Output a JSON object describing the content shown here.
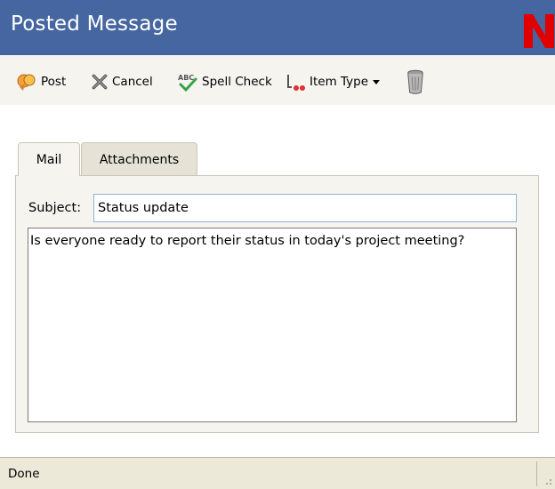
{
  "window": {
    "title": "Posted Message",
    "title_color": "#ffffff",
    "titlebar_bg": "#4566a0",
    "logo_letter": "N",
    "logo_color": "#e00000"
  },
  "toolbar": {
    "post_label": "Post",
    "cancel_label": "Cancel",
    "spell_label": "Spell Check",
    "item_type_label": "Item Type",
    "icons": [
      "post-icon",
      "cancel-icon",
      "spell-check-icon",
      "item-type-icon",
      "chevron-down-icon",
      "trash-icon"
    ]
  },
  "tabs": [
    {
      "label": "Mail",
      "active": true
    },
    {
      "label": "Attachments",
      "active": false
    }
  ],
  "form": {
    "subject_label": "Subject:",
    "subject_value": "Status update",
    "body_value": "Is everyone ready to report their status in today's project meeting?"
  },
  "status": {
    "text": "Done"
  }
}
